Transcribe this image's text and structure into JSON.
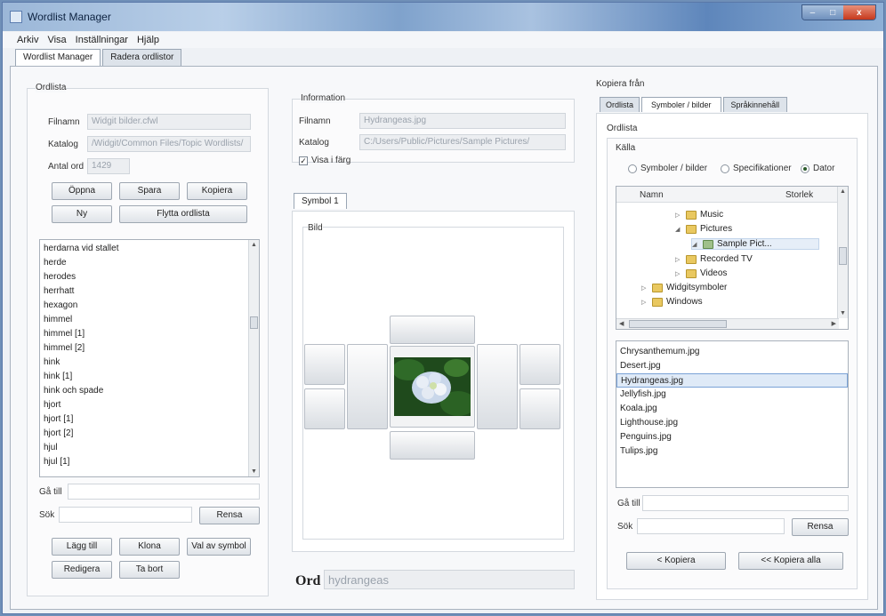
{
  "window": {
    "title": "Wordlist Manager",
    "controls": [
      "–",
      "□",
      "x"
    ]
  },
  "menu": [
    "Arkiv",
    "Visa",
    "Inställningar",
    "Hjälp"
  ],
  "tabs": [
    "Wordlist Manager",
    "Radera ordlistor"
  ],
  "ordlista": {
    "group_label": "Ordlista",
    "filnamn_label": "Filnamn",
    "filnamn_value": "Widgit bilder.cfwl",
    "katalog_label": "Katalog",
    "katalog_value": "/Widgit/Common Files/Topic Wordlists/",
    "antal_label": "Antal ord",
    "antal_value": "1429",
    "buttons": {
      "open": "Öppna",
      "save": "Spara",
      "copy": "Kopiera",
      "new": "Ny",
      "move": "Flytta ordlista"
    },
    "words": [
      "herdarna vid stallet",
      "herde",
      "herodes",
      "herrhatt",
      "hexagon",
      "himmel",
      "himmel [1]",
      "himmel [2]",
      "hink",
      "hink [1]",
      "hink och spade",
      "hjort",
      "hjort [1]",
      "hjort [2]",
      "hjul",
      "hjul [1]"
    ],
    "goto_label": "Gå till",
    "search_label": "Sök",
    "clear": "Rensa",
    "actions": {
      "add": "Lägg till",
      "clone": "Klona",
      "choose_symbol": "Val av symbol",
      "edit": "Redigera",
      "delete": "Ta bort"
    }
  },
  "information": {
    "group_label": "Information",
    "filnamn_label": "Filnamn",
    "filnamn_value": "Hydrangeas.jpg",
    "katalog_label": "Katalog",
    "katalog_value": "C:/Users/Public/Pictures/Sample Pictures/",
    "color_label": "Visa i färg",
    "color_checked": "✓"
  },
  "symbol": {
    "tab": "Symbol 1",
    "bild_label": "Bild"
  },
  "word": {
    "label": "Ord",
    "value": "hydrangeas"
  },
  "copy_from": {
    "label": "Kopiera från",
    "tabs": [
      "Ordlista",
      "Symboler / bilder",
      "Språkinnehåll"
    ],
    "group_label": "Ordlista",
    "source_label": "Källa",
    "radios": [
      "Symboler / bilder",
      "Specifikationer",
      "Dator"
    ],
    "tree_headers": {
      "name": "Namn",
      "size": "Storlek"
    },
    "tree": [
      "Music",
      "Pictures",
      "Sample Pict...",
      "Recorded TV",
      "Videos",
      "Widgitsymboler",
      "Windows"
    ],
    "files": [
      "Chrysanthemum.jpg",
      "Desert.jpg",
      "Hydrangeas.jpg",
      "Jellyfish.jpg",
      "Koala.jpg",
      "Lighthouse.jpg",
      "Penguins.jpg",
      "Tulips.jpg"
    ],
    "goto_label": "Gå till",
    "search_label": "Sök",
    "clear": "Rensa",
    "copy": "< Kopiera",
    "copy_all": "<< Kopiera alla"
  }
}
